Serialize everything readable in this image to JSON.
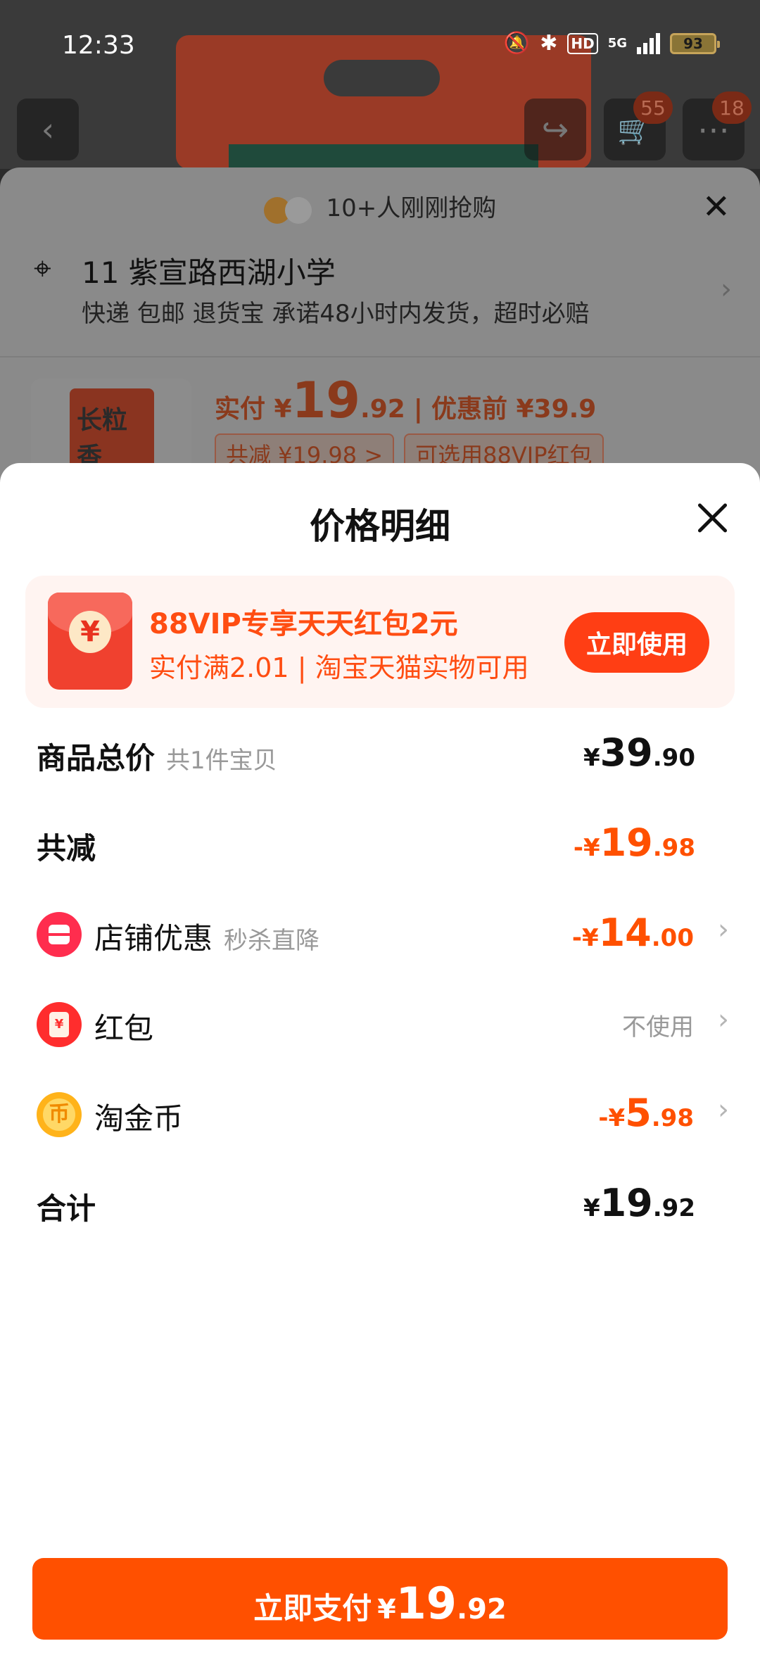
{
  "status_bar": {
    "time": "12:33",
    "network": "5G",
    "hd": "HD",
    "battery": "93"
  },
  "product_page": {
    "cart_badge": "55",
    "more_badge": "18"
  },
  "order_sheet": {
    "recent_buyers": "10+人刚刚抢购",
    "address": "11 紫宣路西湖小学",
    "shipping": "快递 包邮 退货宝 承诺48小时内发货，超时必赔",
    "product_image_text": "长粒香",
    "price_prefix": "实付 ¥",
    "price_int": "19",
    "price_dec": ".92",
    "original_price": "优惠前 ¥39.9",
    "discount_tag": "共减 ¥19.98 >",
    "vip_tag": "可选用88VIP红包"
  },
  "price_detail": {
    "title": "价格明细",
    "vip_banner": {
      "icon_char": "¥",
      "title": "88VIP专享天天红包2元",
      "subtitle": "实付满2.01 | 淘宝天猫实物可用",
      "button": "立即使用"
    },
    "rows": [
      {
        "label": "商品总价",
        "hint": "共1件宝贝",
        "yen": "¥",
        "int": "39",
        "dec": ".90"
      },
      {
        "label": "共减",
        "yen": "-¥",
        "int": "19",
        "dec": ".98"
      },
      {
        "label": "店铺优惠",
        "hint": "秒杀直降",
        "yen": "-¥",
        "int": "14",
        "dec": ".00"
      },
      {
        "label": "红包",
        "status": "不使用"
      },
      {
        "label": "淘金币",
        "yen": "-¥",
        "int": "5",
        "dec": ".98"
      },
      {
        "label": "合计",
        "yen": "¥",
        "int": "19",
        "dec": ".92"
      }
    ],
    "pay_button": {
      "label": "立即支付",
      "yen": "¥",
      "int": "19",
      "dec": ".92"
    }
  },
  "colors": {
    "accent": "#ff5000",
    "vip_accent": "#ff4d12",
    "muted_text": "#999999"
  },
  "icons": [
    "back-icon",
    "share-icon",
    "cart-icon",
    "more-icon",
    "close-icon",
    "location-pin-icon",
    "shop-icon",
    "red-packet-icon",
    "gold-coin-icon",
    "chevron-right-icon"
  ]
}
